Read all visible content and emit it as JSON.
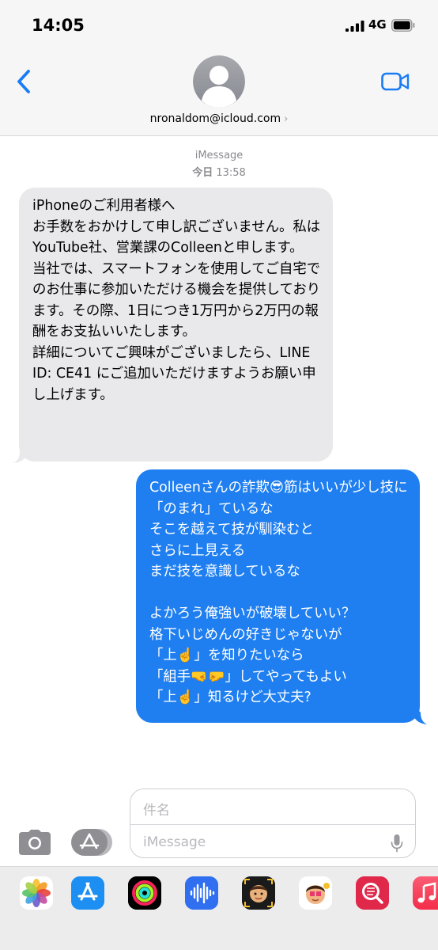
{
  "status_bar": {
    "time": "14:05",
    "network": "4G"
  },
  "header": {
    "contact": "nronaldom@icloud.com",
    "chevron": "›"
  },
  "thread": {
    "service": "iMessage",
    "day": "今日",
    "time": "13:58"
  },
  "messages": [
    {
      "direction": "incoming",
      "text": "iPhoneのご利用者様へ\n お手数をおかけして申し訳ございません。私はYouTube社、営業課のColleenと申します。\n 当社では、スマートフォンを使用してご自宅でのお仕事に参加いただける機会を提供しております。その際、1日につき1万円から2万円の報酬をお支払いいたします。\n詳細についてご興味がございましたら、LINE ID: CE41 にご追加いただけますようお願い申し上げます。"
    },
    {
      "direction": "outgoing",
      "text": "Colleenさんの詐欺😎筋はいいが少し技に「のまれ」ているな\nそこを越えて技が馴染むと\nさらに上見える\nまだ技を意識しているな\n\nよかろう俺強いが破壊していい？\n格下いじめんの好きじゃないが\n「上☝️」を知りたいなら\n「組手🤜🤛」してやってもよい\n「上☝️」知るけど大丈夫?"
    }
  ],
  "compose": {
    "subject_placeholder": "件名",
    "message_placeholder": "iMessage"
  },
  "icons": {
    "back": "chevron-left-icon",
    "video": "video-camera-icon",
    "camera": "camera-icon",
    "apps": "app-store-icon",
    "mic": "microphone-icon"
  },
  "app_drawer": [
    {
      "name": "photos-app-icon"
    },
    {
      "name": "app-store-app-icon"
    },
    {
      "name": "activity-app-icon"
    },
    {
      "name": "audio-message-app-icon"
    },
    {
      "name": "memoji-app-icon"
    },
    {
      "name": "memoji-stickers-app-icon"
    },
    {
      "name": "images-search-app-icon"
    },
    {
      "name": "music-app-icon"
    }
  ],
  "colors": {
    "outgoing_bubble": "#1f7ff0",
    "incoming_bubble": "#e9e9eb",
    "accent": "#1a7cf5"
  }
}
